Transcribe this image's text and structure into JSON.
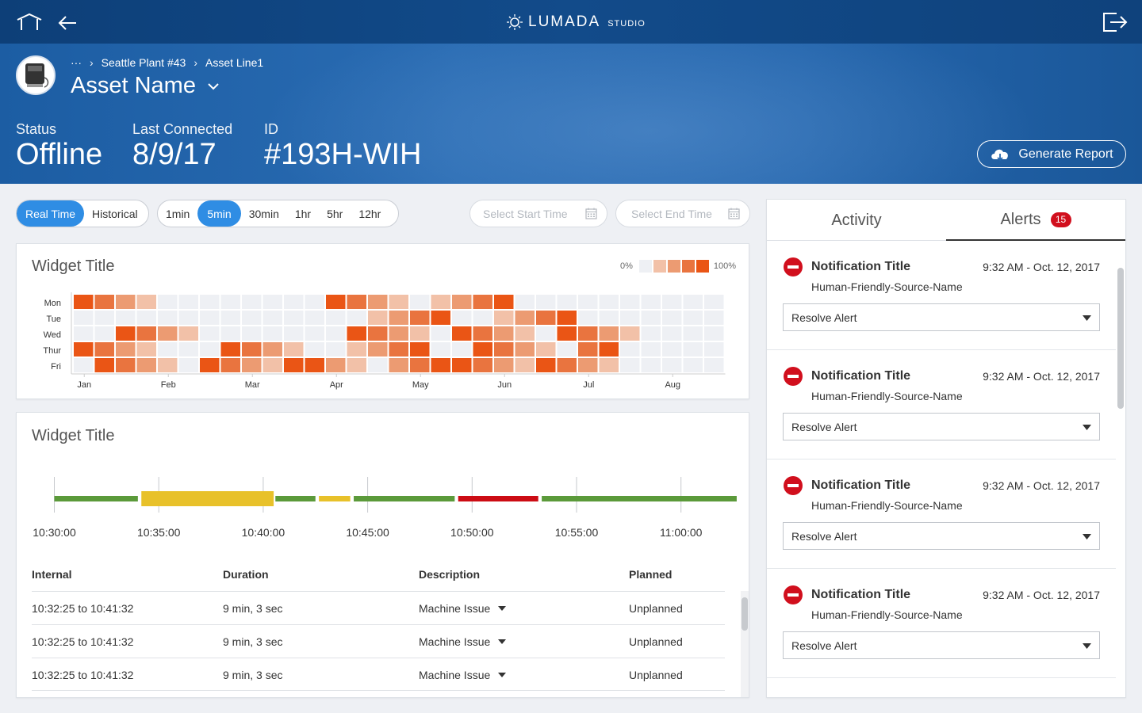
{
  "header": {
    "brand_name": "LUMADA",
    "brand_sub": "STUDIO",
    "breadcrumb": {
      "ellipsis": "···",
      "items": [
        "Seattle Plant #43",
        "Asset Line1"
      ]
    },
    "asset_name": "Asset Name",
    "status": {
      "label": "Status",
      "value": "Offline"
    },
    "last_connected": {
      "label": "Last Connected",
      "value": "8/9/17"
    },
    "id": {
      "label": "ID",
      "value": "#193H-WIH"
    },
    "generate_report": "Generate Report",
    "icons": [
      "home-icon",
      "back-arrow-icon",
      "logout-icon",
      "cloud-download-icon",
      "chevron-down-icon"
    ]
  },
  "controls": {
    "mode": [
      {
        "label": "Real Time",
        "active": true
      },
      {
        "label": "Historical",
        "active": false
      }
    ],
    "intervals": [
      {
        "label": "1min",
        "active": false
      },
      {
        "label": "5min",
        "active": true
      },
      {
        "label": "30min",
        "active": false
      },
      {
        "label": "1hr",
        "active": false
      },
      {
        "label": "5hr",
        "active": false
      },
      {
        "label": "12hr",
        "active": false
      }
    ],
    "start_placeholder": "Select Start Time",
    "end_placeholder": "Select End Time"
  },
  "heatmap_widget": {
    "title": "Widget Title",
    "legend_min": "0%",
    "legend_max": "100%"
  },
  "timeline_widget": {
    "title": "Widget Title",
    "table": {
      "headers": [
        "Internal",
        "Duration",
        "Description",
        "Planned"
      ],
      "rows": [
        [
          "10:32:25 to 10:41:32",
          "9 min, 3 sec",
          "Machine Issue",
          "Unplanned"
        ],
        [
          "10:32:25 to 10:41:32",
          "9 min, 3 sec",
          "Machine Issue",
          "Unplanned"
        ],
        [
          "10:32:25 to 10:41:32",
          "9 min, 3 sec",
          "Machine Issue",
          "Unplanned"
        ]
      ]
    }
  },
  "alerts_panel": {
    "tabs": [
      {
        "label": "Activity",
        "active": false
      },
      {
        "label": "Alerts",
        "active": true,
        "count": "15"
      }
    ],
    "alerts": [
      {
        "title": "Notification Title",
        "time": "9:32 AM - Oct. 12, 2017",
        "source": "Human-Friendly-Source-Name",
        "action": "Resolve Alert"
      },
      {
        "title": "Notification Title",
        "time": "9:32 AM - Oct. 12, 2017",
        "source": "Human-Friendly-Source-Name",
        "action": "Resolve Alert"
      },
      {
        "title": "Notification Title",
        "time": "9:32 AM - Oct. 12, 2017",
        "source": "Human-Friendly-Source-Name",
        "action": "Resolve Alert"
      },
      {
        "title": "Notification Title",
        "time": "9:32 AM - Oct. 12, 2017",
        "source": "Human-Friendly-Source-Name",
        "action": "Resolve Alert"
      }
    ]
  },
  "colors": {
    "accent": "#2f8de4",
    "alert_red": "#d10f1d",
    "heat_levels": [
      "#eef0f4",
      "#f2c1a8",
      "#ec9b72",
      "#e9743f",
      "#ea5515"
    ],
    "timeline_green": "#5b9a3a",
    "timeline_yellow": "#e8c12a",
    "timeline_red": "#cc0c14"
  },
  "chart_data": [
    {
      "type": "heatmap",
      "title": "Widget Title",
      "y_categories": [
        "Mon",
        "Tue",
        "Wed",
        "Thur",
        "Fri"
      ],
      "x_tick_labels": [
        "Jan",
        "Feb",
        "Mar",
        "Apr",
        "May",
        "Jun",
        "Jul",
        "Aug"
      ],
      "scale": [
        0,
        4
      ],
      "legend": "top-right",
      "values": [
        [
          4,
          3,
          2,
          1,
          0,
          0,
          0,
          0,
          0,
          0,
          0,
          0,
          4,
          3,
          2,
          1,
          0,
          1,
          2,
          3,
          4,
          0,
          0,
          0,
          0,
          0,
          0,
          0,
          0,
          0,
          0
        ],
        [
          0,
          0,
          0,
          0,
          0,
          0,
          0,
          0,
          0,
          0,
          0,
          0,
          0,
          0,
          1,
          2,
          3,
          4,
          0,
          0,
          1,
          2,
          3,
          4,
          0,
          0,
          0,
          0,
          0,
          0,
          0
        ],
        [
          0,
          0,
          4,
          3,
          2,
          1,
          0,
          0,
          0,
          0,
          0,
          0,
          0,
          4,
          3,
          2,
          1,
          0,
          4,
          3,
          2,
          1,
          0,
          4,
          3,
          2,
          1,
          0,
          0,
          0,
          0
        ],
        [
          4,
          3,
          2,
          1,
          0,
          0,
          0,
          4,
          3,
          2,
          1,
          0,
          0,
          1,
          2,
          3,
          4,
          0,
          0,
          4,
          3,
          2,
          1,
          0,
          3,
          4,
          0,
          0,
          0,
          0,
          0
        ],
        [
          0,
          4,
          3,
          2,
          1,
          0,
          4,
          3,
          2,
          1,
          4,
          4,
          2,
          1,
          0,
          2,
          3,
          4,
          4,
          3,
          2,
          1,
          4,
          3,
          2,
          1,
          0,
          0,
          0,
          0,
          0
        ]
      ]
    },
    {
      "type": "timeline",
      "title": "Widget Title",
      "x_tick_labels": [
        "10:30:00",
        "10:35:00",
        "10:40:00",
        "10:45:00",
        "10:50:00",
        "10:55:00",
        "11:00:00"
      ],
      "segments": [
        {
          "start": "10:30:00",
          "end": "10:34:00",
          "state": "green"
        },
        {
          "start": "10:34:10",
          "end": "10:40:30",
          "state": "yellow"
        },
        {
          "start": "10:40:35",
          "end": "10:42:30",
          "state": "green"
        },
        {
          "start": "10:42:40",
          "end": "10:44:10",
          "state": "yellow"
        },
        {
          "start": "10:44:20",
          "end": "10:49:10",
          "state": "green"
        },
        {
          "start": "10:49:20",
          "end": "10:53:10",
          "state": "red"
        },
        {
          "start": "10:53:20",
          "end": "11:02:40",
          "state": "green"
        }
      ]
    }
  ]
}
